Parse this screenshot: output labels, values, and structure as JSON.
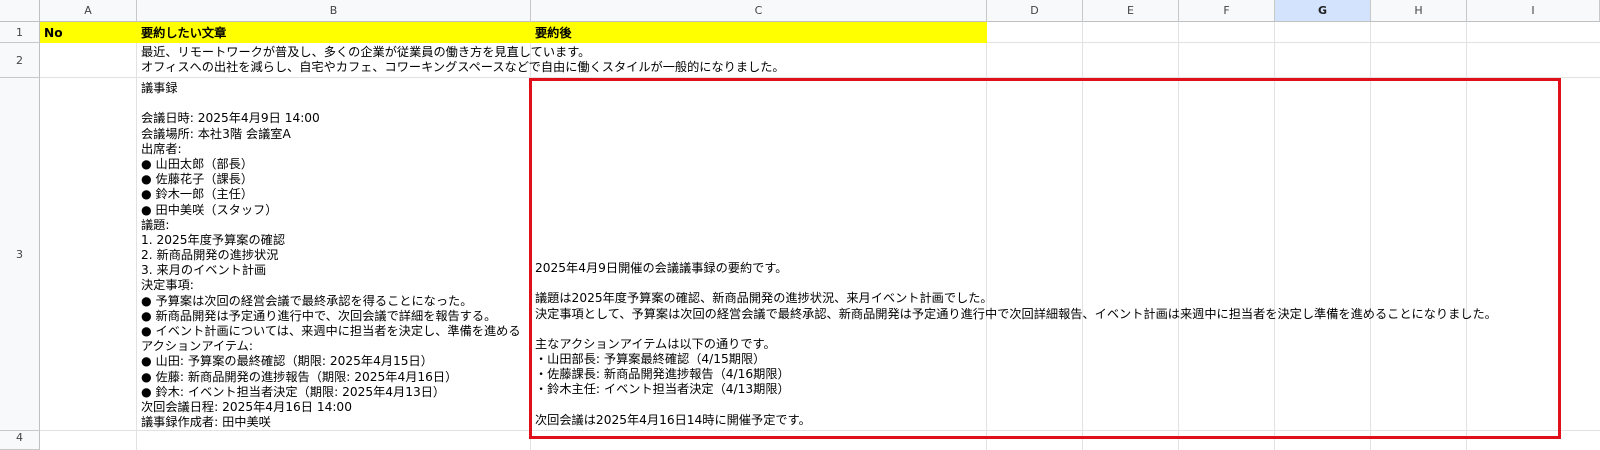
{
  "columns": [
    "A",
    "B",
    "C",
    "D",
    "E",
    "F",
    "G",
    "H",
    "I"
  ],
  "rows": [
    "1",
    "2",
    "3",
    "4"
  ],
  "selected_column": "G",
  "header_row": {
    "no": "No",
    "source": "要約したい文章",
    "summary": "要約後"
  },
  "row2": {
    "b_lines": [
      "最近、リモートワークが普及し、多くの企業が従業員の働き方を見直しています。",
      "オフィスへの出社を減らし、自宅やカフェ、コワーキングスペースなどで自由に働くスタイルが一般的になりました。"
    ]
  },
  "row3": {
    "b_lines": [
      "議事録",
      "",
      "会議日時: 2025年4月9日 14:00",
      "会議場所: 本社3階 会議室A",
      "出席者:",
      "● 山田太郎（部長）",
      "● 佐藤花子（課長）",
      "● 鈴木一郎（主任）",
      "● 田中美咲（スタッフ）",
      "議題:",
      "1. 2025年度予算案の確認",
      "2. 新商品開発の進捗状況",
      "3. 来月のイベント計画",
      "決定事項:",
      "● 予算案は次回の経営会議で最終承認を得ることになった。",
      "● 新商品開発は予定通り進行中で、次回会議で詳細を報告する。",
      "● イベント計画については、来週中に担当者を決定し、準備を進める",
      "アクションアイテム:",
      "● 山田: 予算案の最終確認（期限: 2025年4月15日）",
      "● 佐藤: 新商品開発の進捗報告（期限: 2025年4月16日）",
      "● 鈴木: イベント担当者決定（期限: 2025年4月13日）",
      "次回会議日程: 2025年4月16日 14:00",
      "議事録作成者: 田中美咲"
    ],
    "c_lines": [
      "2025年4月9日開催の会議議事録の要約です。",
      "",
      "議題は2025年度予算案の確認、新商品開発の進捗状況、来月イベント計画でした。",
      "決定事項として、予算案は次回の経営会議で最終承認、新商品開発は予定通り進行中で次回詳細報告、イベント計画は来週中に担当者を決定し準備を進めることになりました。",
      "",
      "主なアクションアイテムは以下の通りです。",
      "・山田部長: 予算案最終確認（4/15期限）",
      "・佐藤課長: 新商品開発進捗報告（4/16期限）",
      "・鈴木主任: イベント担当者決定（4/13期限）",
      "",
      "次回会議は2025年4月16日14時に開催予定です。"
    ]
  },
  "colors": {
    "header_fill": "#ffff00",
    "selection_border": "#e0101a",
    "selected_col_header": "#d3e3fd"
  }
}
